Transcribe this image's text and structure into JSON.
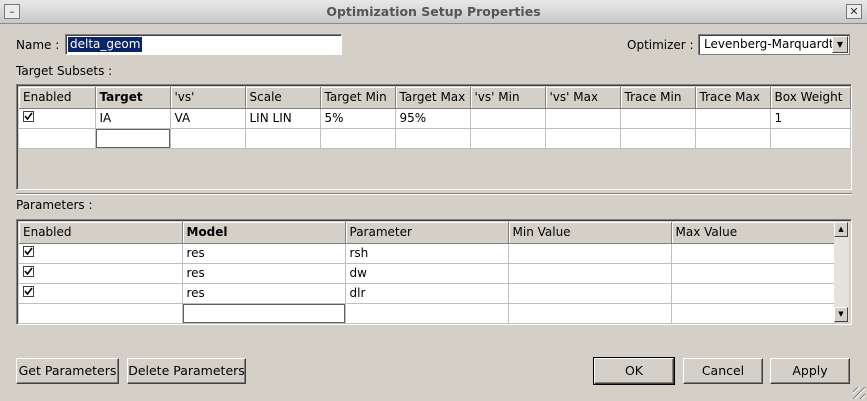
{
  "window": {
    "title": "Optimization Setup Properties",
    "minimize_glyph": "–",
    "close_glyph": "✕"
  },
  "form": {
    "name_label": "Name :",
    "name_value": "delta_geom",
    "optimizer_label": "Optimizer :",
    "optimizer_value": "Levenberg-Marquardt"
  },
  "target_subsets": {
    "label": "Target Subsets :",
    "columns": [
      "Enabled",
      "Target",
      "'vs'",
      "Scale",
      "Target Min",
      "Target Max",
      "'vs' Min",
      "'vs' Max",
      "Trace Min",
      "Trace Max",
      "Box Weight"
    ],
    "rows": [
      {
        "enabled": true,
        "cells": [
          "IA",
          "VA",
          "LIN LIN",
          "5%",
          "95%",
          "",
          "",
          "",
          "",
          "1"
        ]
      }
    ]
  },
  "parameters": {
    "label": "Parameters :",
    "columns": [
      "Enabled",
      "Model",
      "Parameter",
      "Min Value",
      "Max Value"
    ],
    "rows": [
      {
        "enabled": true,
        "cells": [
          "res",
          "rsh",
          "",
          ""
        ]
      },
      {
        "enabled": true,
        "cells": [
          "res",
          "dw",
          "",
          ""
        ]
      },
      {
        "enabled": true,
        "cells": [
          "res",
          "dlr",
          "",
          ""
        ]
      }
    ]
  },
  "buttons": {
    "get_parameters": "Get Parameters",
    "delete_parameters": "Delete Parameters",
    "ok": "OK",
    "cancel": "Cancel",
    "apply": "Apply"
  },
  "icons": {
    "checkbox_checked": "check-icon",
    "combo_arrow": "chevron-down-icon"
  }
}
